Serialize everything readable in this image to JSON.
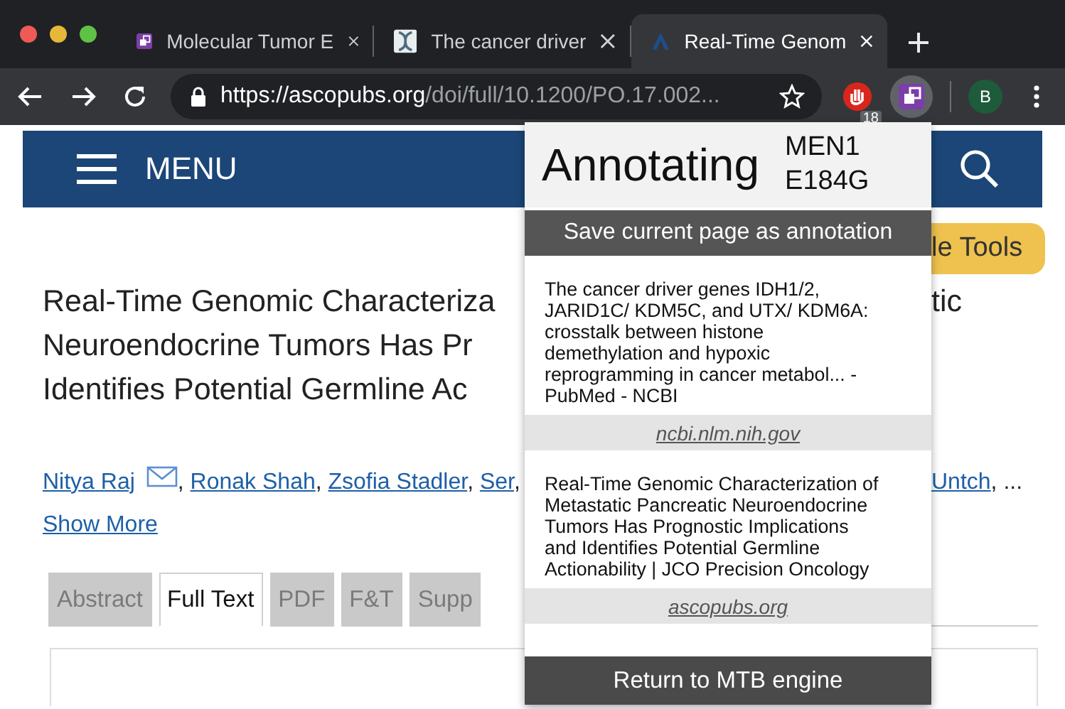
{
  "browser": {
    "tabs": [
      {
        "kind": "extension",
        "title": "Molecular Tumor E",
        "selected": false
      },
      {
        "kind": "helix",
        "title": "The cancer driver",
        "selected": false
      },
      {
        "kind": "journal",
        "title": "Real-Time Genom",
        "selected": true
      }
    ],
    "address": {
      "origin": "https://ascopubs.org",
      "path": "/doi/full/10.1200/PO.17.002..."
    },
    "extensions": [
      {
        "kind": "blocker",
        "badge": "18",
        "selected": false
      },
      {
        "kind": "annotator",
        "selected": true
      }
    ],
    "profile": "B"
  },
  "page": {
    "menu": "MENU",
    "tools_button": "le Tools",
    "title_lines": [
      "Real-Time Genomic Characteriza",
      "Neuroendocrine Tumors Has Pr",
      "Identifies Potential Germline Ac"
    ],
    "title_right": "tic",
    "authors_left": [
      {
        "name": "Nitya Raj",
        "email": true
      },
      {
        "name": "Ronak Shah",
        "email": false
      },
      {
        "name": "Zsofia Stadler",
        "email": false
      },
      {
        "name": "Ser",
        "email": false
      }
    ],
    "authors_right": [
      {
        "name": "Untch",
        "email": false
      }
    ],
    "authors_more": "...",
    "separator": ",",
    "show_more": "Show More",
    "tabs": [
      {
        "label": "Abstract",
        "selected": false
      },
      {
        "label": "Full Text",
        "selected": true
      },
      {
        "label": "PDF",
        "selected": false
      },
      {
        "label": "F&T",
        "selected": false
      },
      {
        "label": "Supp",
        "selected": false
      }
    ]
  },
  "popup": {
    "title": "Annotating",
    "gene": "MEN1",
    "variant": "E184G",
    "save_button": "Save current page as annotation",
    "annotations": [
      {
        "title": "The cancer driver genes IDH1/2, JARID1C/ KDM5C, and UTX/ KDM6A: crosstalk between histone demethylation and hypoxic reprogramming in cancer metabol... - PubMed - NCBI",
        "source": "ncbi.nlm.nih.gov"
      },
      {
        "title": "Real-Time Genomic Characterization of Metastatic Pancreatic Neuroendocrine Tumors Has Prognostic Implications and Identifies Potential Germline Actionability | JCO Precision Oncology",
        "source": "ascopubs.org"
      }
    ],
    "return_button": "Return to MTB engine"
  }
}
